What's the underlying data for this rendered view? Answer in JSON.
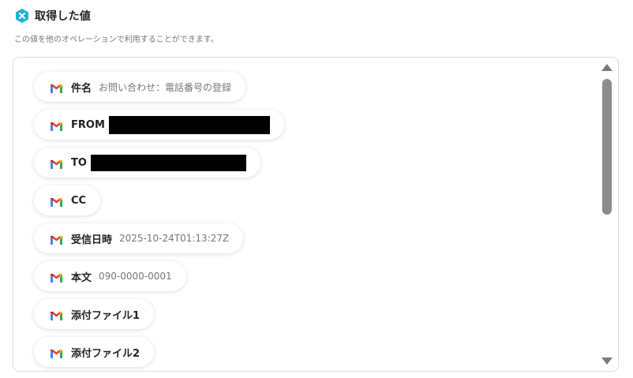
{
  "header": {
    "title": "取得した値",
    "icon": "yoom-x-icon",
    "icon_color": "#1db0d8"
  },
  "subtitle": "この値を他のオペレーションで利用することができます。",
  "fields": [
    {
      "label": "件名",
      "value": "お問い合わせ：電話番号の登録",
      "icon": "gmail-icon"
    },
    {
      "label": "FROM",
      "value": "",
      "redacted": true,
      "icon": "gmail-icon"
    },
    {
      "label": "TO",
      "value": "",
      "redacted": true,
      "icon": "gmail-icon"
    },
    {
      "label": "CC",
      "value": "",
      "icon": "gmail-icon"
    },
    {
      "label": "受信日時",
      "value": "2025-10-24T01:13:27Z",
      "icon": "gmail-icon"
    },
    {
      "label": "本文",
      "value": "090-0000-0001",
      "icon": "gmail-icon"
    },
    {
      "label": "添付ファイル1",
      "value": "",
      "icon": "gmail-icon"
    },
    {
      "label": "添付ファイル2",
      "value": "",
      "icon": "gmail-icon"
    }
  ],
  "scrollbar": {
    "up_icon": "scroll-up-arrow-icon",
    "down_icon": "scroll-down-arrow-icon"
  }
}
